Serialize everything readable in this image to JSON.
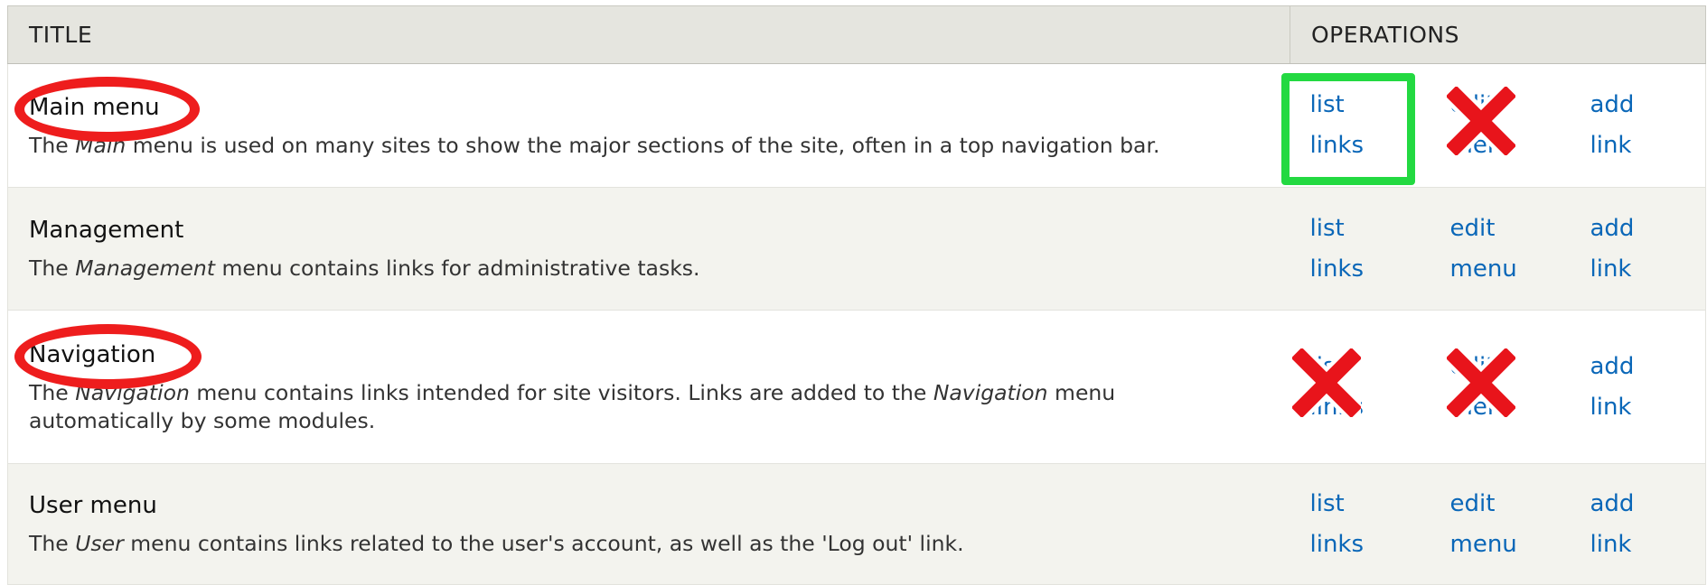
{
  "header": {
    "title_col": "TITLE",
    "ops_col": "OPERATIONS"
  },
  "rows": [
    {
      "name": "Main menu",
      "desc_pre": "The ",
      "desc_em": "Main",
      "desc_post": " menu is used on many sites to show the major sections of the site, often in a top navigation bar.",
      "ops": {
        "list_line1": "list",
        "list_line2": "links",
        "edit_line1": "edit",
        "edit_line2": "menu",
        "add_line1": "add",
        "add_line2": "link"
      },
      "annotations": {
        "name_circled": true,
        "list_highlighted": true,
        "edit_crossed": true
      }
    },
    {
      "name": "Management",
      "desc_pre": "The ",
      "desc_em": "Management",
      "desc_post": " menu contains links for administrative tasks.",
      "ops": {
        "list_line1": "list",
        "list_line2": "links",
        "edit_line1": "edit",
        "edit_line2": "menu",
        "add_line1": "add",
        "add_line2": "link"
      }
    },
    {
      "name": "Navigation",
      "desc_pre": "The ",
      "desc_em": "Navigation",
      "desc_mid": " menu contains links intended for site visitors. Links are added to the ",
      "desc_em2": "Navigation",
      "desc_post": " menu",
      "desc_line2": "automatically by some modules.",
      "ops": {
        "list_line1": "list",
        "list_line2": "links",
        "edit_line1": "edit",
        "edit_line2": "menu",
        "add_line1": "add",
        "add_line2": "link"
      },
      "annotations": {
        "name_circled": true,
        "list_crossed": true,
        "edit_crossed": true
      }
    },
    {
      "name": "User menu",
      "desc_pre": "The ",
      "desc_em": "User",
      "desc_post": " menu contains links related to the user's account, as well as the 'Log out' link.",
      "ops": {
        "list_line1": "list",
        "list_line2": "links",
        "edit_line1": "edit",
        "edit_line2": "menu",
        "add_line1": "add",
        "add_line2": "link"
      }
    }
  ],
  "annotation_colors": {
    "circle": "#ee1d1d",
    "highlight_box": "#23d941",
    "cross": "#e8141b"
  }
}
